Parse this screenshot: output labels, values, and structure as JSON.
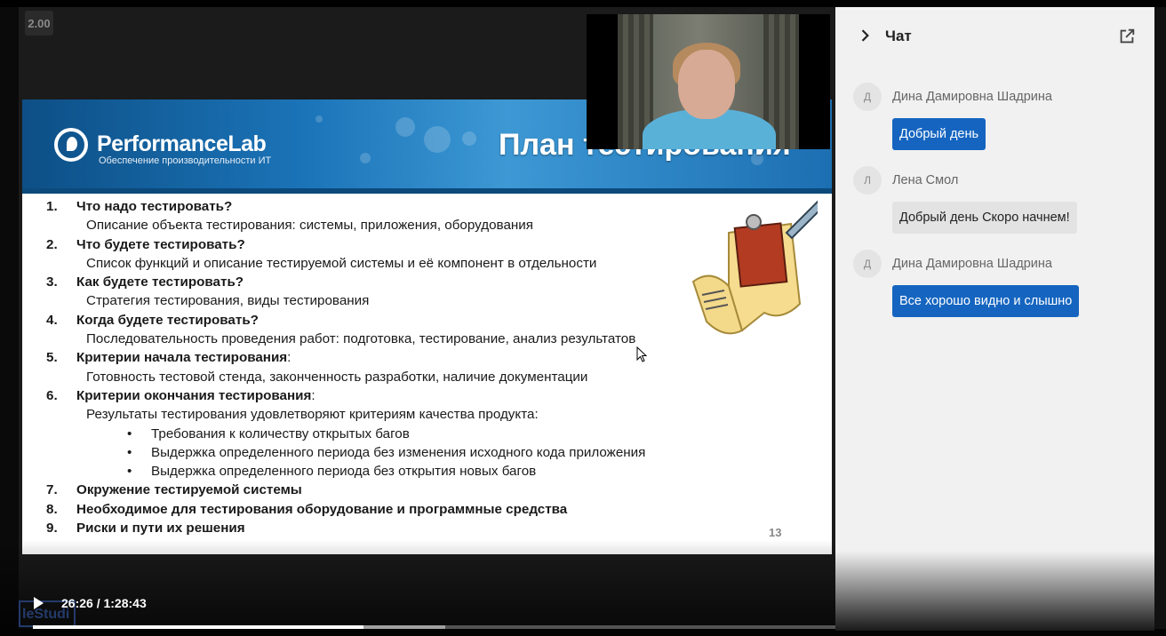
{
  "player": {
    "speed": "2.00",
    "current_time": "26:26",
    "separator": " / ",
    "duration": "1:28:43",
    "progress_fraction": 0.298,
    "buffered_fraction": 0.372,
    "watermark": "leStudi"
  },
  "slide": {
    "logo_name": "PerformanceLab",
    "logo_subtitle": "Обеспечение производительности ИТ",
    "title": "План тестирования",
    "page_number": "13",
    "items": [
      {
        "num": "1.",
        "head": "Что надо тестировать?",
        "head_suffix": "",
        "desc": "Описание объекта тестирования: системы, приложения, оборудования"
      },
      {
        "num": "2.",
        "head": "Что будете тестировать?",
        "head_suffix": "",
        "desc": "Список функций и описание тестируемой системы и её компонент в отдельности"
      },
      {
        "num": "3.",
        "head": "Как будете тестировать?",
        "head_suffix": "",
        "desc": "Стратегия тестирования, виды тестирования"
      },
      {
        "num": "4.",
        "head": "Когда будете тестировать?",
        "head_suffix": "",
        "desc": "Последовательность проведения работ: подготовка, тестирование, анализ результатов"
      },
      {
        "num": "5.",
        "head": "Критерии начала тестирования",
        "head_suffix": ":",
        "desc": "Готовность тестовой стенда, законченность разработки, наличие документации"
      },
      {
        "num": "6.",
        "head": "Критерии окончания тестирования",
        "head_suffix": ":",
        "desc": "Результаты тестирования удовлетворяют критериям качества продукта:"
      },
      {
        "num": "7.",
        "head": "Окружение тестируемой системы",
        "head_suffix": "",
        "desc": ""
      },
      {
        "num": "8.",
        "head": "Необходимое для тестирования оборудование и программные средства",
        "head_suffix": "",
        "desc": ""
      },
      {
        "num": "9.",
        "head": "Риски и пути их решения",
        "head_suffix": "",
        "desc": ""
      }
    ],
    "bullets": [
      "Требования к количеству открытых багов",
      "Выдержка определенного периода без изменения исходного кода приложения",
      "Выдержка определенного периода без открытия новых багов"
    ]
  },
  "chat": {
    "title": "Чат",
    "messages": [
      {
        "initial": "Д",
        "author": "Дина Дамировна Шадрина",
        "text": "Добрый день",
        "style": "blue"
      },
      {
        "initial": "Л",
        "author": "Лена Смол",
        "text": "Добрый день Скоро начнем!",
        "style": "gray"
      },
      {
        "initial": "Д",
        "author": "Дина Дамировна Шадрина",
        "text": "Все хорошо видно и слышно",
        "style": "blue"
      }
    ]
  },
  "icons": {
    "play": "play-icon",
    "volume": "volume-icon",
    "fullscreen": "fullscreen-icon",
    "more": "more-vert-icon",
    "chat_toggle": "chevron-right-icon",
    "popout": "open-in-new-icon"
  },
  "colors": {
    "chat_bubble_accent": "#1565c0",
    "slide_banner": "#1b74b8"
  }
}
